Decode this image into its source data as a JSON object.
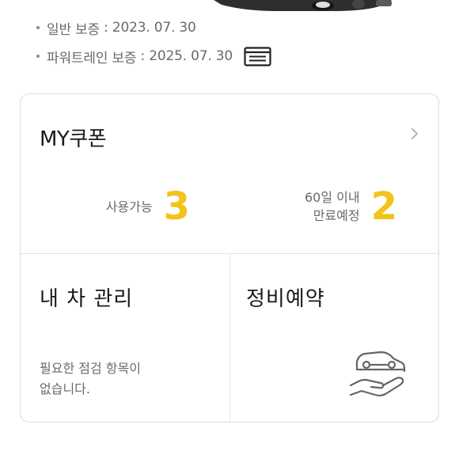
{
  "warranty": [
    {
      "label": "일반 보증",
      "sep": " : ",
      "date": "2023. 07. 30",
      "has_card_icon": false
    },
    {
      "label": "파워트레인 보증",
      "sep": " : ",
      "date": "2025. 07. 30",
      "has_card_icon": true
    }
  ],
  "coupon": {
    "title": "MY쿠폰",
    "available_label": "사용가능",
    "available_count": "3",
    "expiring_label_line1": "60일 이내",
    "expiring_label_line2": "만료예정",
    "expiring_count": "2"
  },
  "tiles": {
    "my_car": {
      "title": "내 차 관리",
      "desc_line1": "필요한 점검 항목이",
      "desc_line2": "없습니다."
    },
    "service": {
      "title": "정비예약"
    }
  },
  "colors": {
    "accent": "#f3c21b",
    "text_muted": "#6a6a6a",
    "border": "#dcdcdc"
  },
  "icons": {
    "card": "card-icon",
    "chevron": "chevron-right-icon",
    "service": "car-care-hand-icon"
  }
}
